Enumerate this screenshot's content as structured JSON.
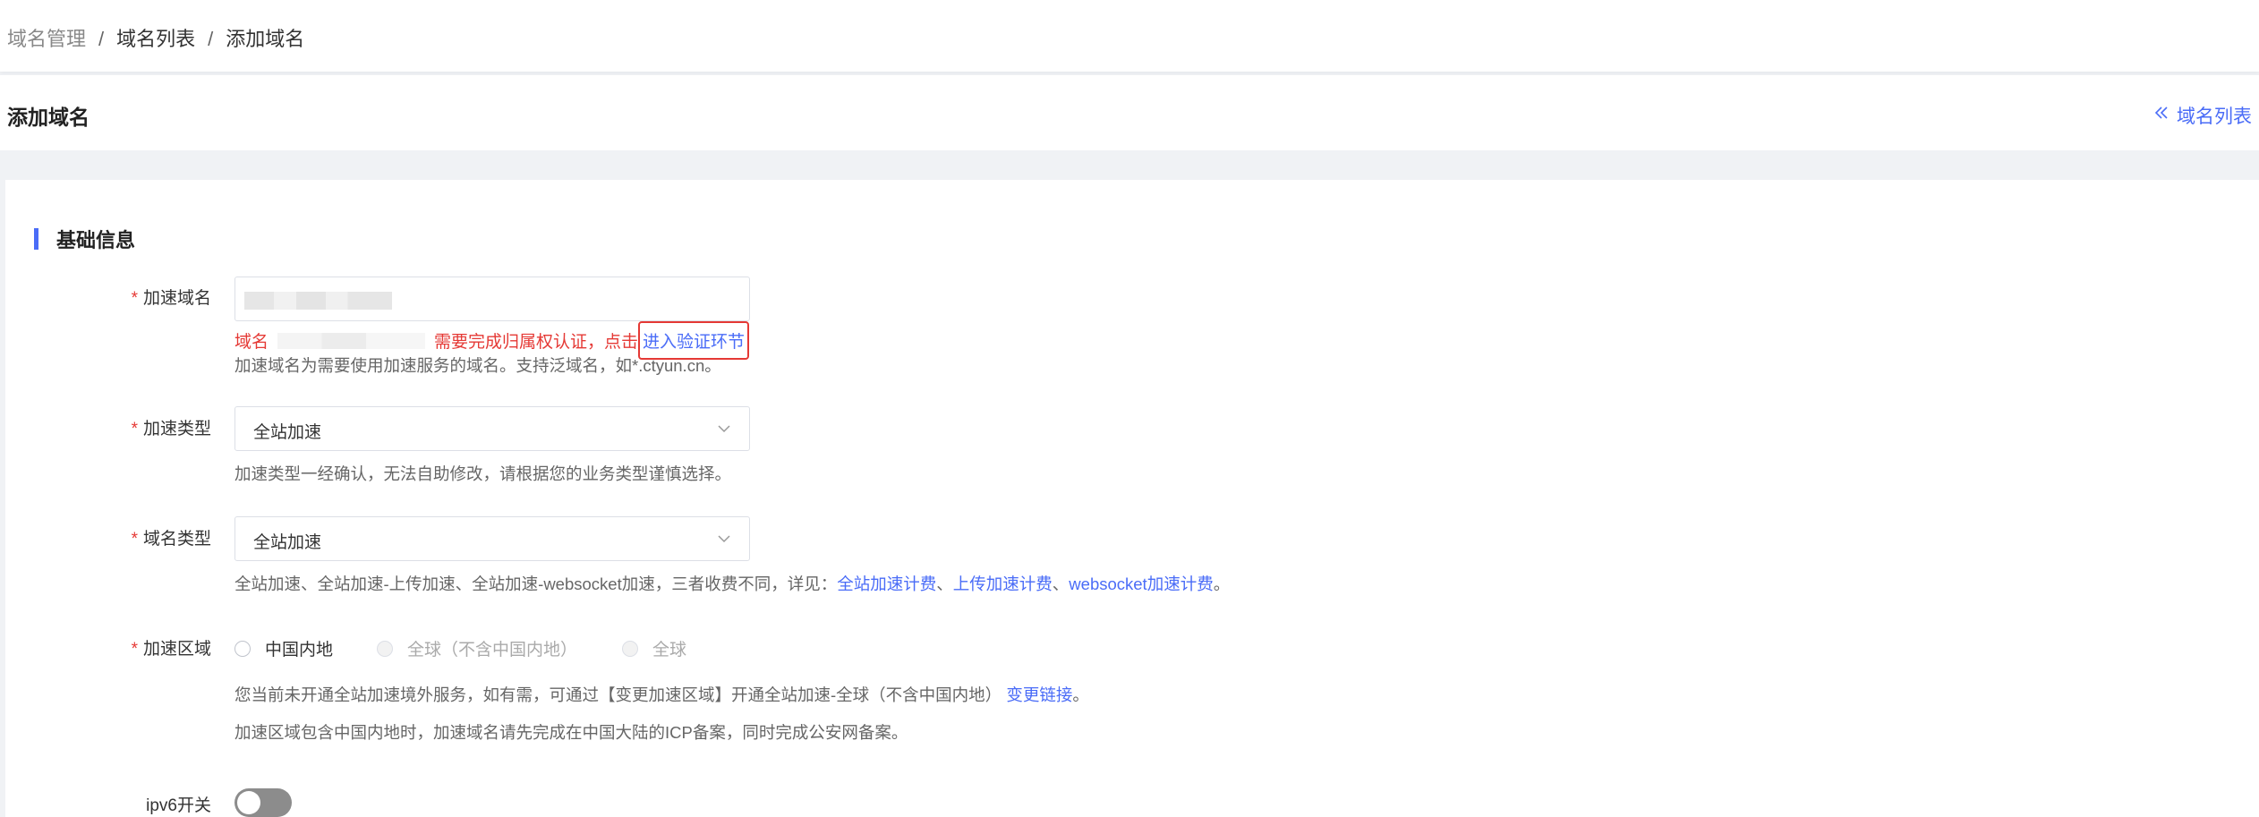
{
  "breadcrumb": {
    "items": [
      "域名管理",
      "域名列表",
      "添加域名"
    ],
    "separator": "/"
  },
  "header": {
    "title": "添加域名",
    "back_link": "域名列表"
  },
  "section": {
    "title": "基础信息"
  },
  "fields": {
    "domain": {
      "required_mark": "*",
      "label": "加速域名",
      "error_prefix": "域名",
      "error_middle": "需要完成归属权认证，点击",
      "error_link": "进入验证环节",
      "help": "加速域名为需要使用加速服务的域名。支持泛域名，如*.ctyun.cn。"
    },
    "accel_type": {
      "required_mark": "*",
      "label": "加速类型",
      "value": "全站加速",
      "help": "加速类型一经确认，无法自助修改，请根据您的业务类型谨慎选择。"
    },
    "domain_type": {
      "required_mark": "*",
      "label": "域名类型",
      "value": "全站加速",
      "help_prefix": "全站加速、全站加速-上传加速、全站加速-websocket加速，三者收费不同，详见：",
      "help_link_1": "全站加速计费",
      "sep_1": "、",
      "help_link_2": "上传加速计费",
      "sep_2": "、",
      "help_link_3": "websocket加速计费",
      "help_suffix": "。"
    },
    "region": {
      "required_mark": "*",
      "label": "加速区域",
      "options": [
        "中国内地",
        "全球（不含中国内地）",
        "全球"
      ],
      "notice_prefix": "您当前未开通全站加速境外服务，如有需，可通过【变更加速区域】开通全站加速-全球（不含中国内地）",
      "notice_link": "变更链接",
      "notice_suffix": "。",
      "help": "加速区域包含中国内地时，加速域名请先完成在中国大陆的ICP备案，同时完成公安网备案。"
    },
    "ipv6": {
      "label": "ipv6开关",
      "enabled": false
    }
  },
  "colors": {
    "accent": "#4a6cf7",
    "error": "#e53935"
  }
}
